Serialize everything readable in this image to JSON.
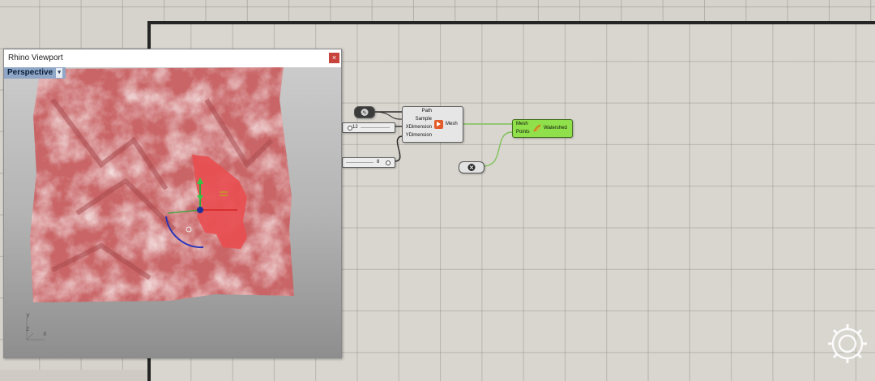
{
  "viewport": {
    "title": "Rhino Viewport",
    "close_glyph": "×",
    "view_name": "Perspective",
    "dropdown_glyph": "▾",
    "axes": {
      "y": "y",
      "z": "z",
      "x": "x"
    }
  },
  "graph": {
    "file_param": {
      "icon": "file-path-icon"
    },
    "slider_x": {
      "value": "12"
    },
    "slider_y": {
      "value": "8"
    },
    "point_param": {
      "icon": "point-icon"
    },
    "mesh_component": {
      "inputs": [
        "Path",
        "Sample",
        "XDimension",
        "YDimension"
      ],
      "output": "Mesh"
    },
    "watershed_component": {
      "inputs": [
        "Mesh",
        "Points"
      ],
      "output": "Watershed",
      "color": "#8fe04a"
    }
  },
  "colors": {
    "terrain": "#c85c5e",
    "terrain_highlight": "#e85050",
    "canvas": "#d6d3cd"
  }
}
